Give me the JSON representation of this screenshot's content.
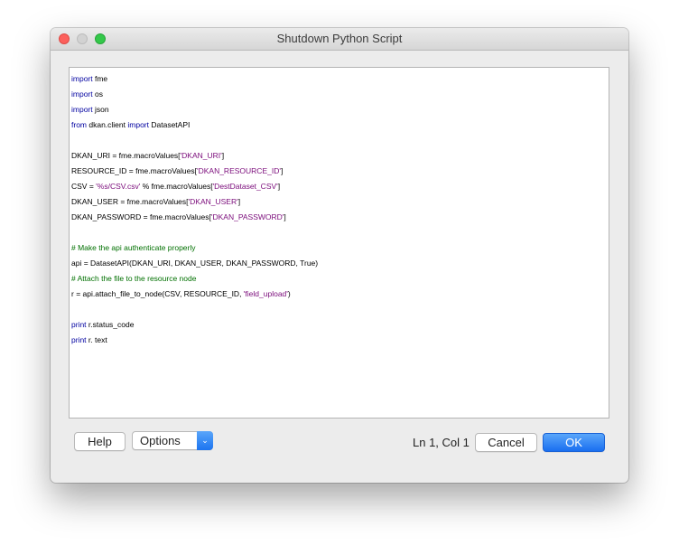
{
  "window": {
    "title": "Shutdown Python Script"
  },
  "editor": {
    "lines": [
      [
        {
          "t": "import",
          "c": "kw"
        },
        {
          "t": " fme",
          "c": "plain"
        }
      ],
      [
        {
          "t": "import",
          "c": "kw"
        },
        {
          "t": " os",
          "c": "plain"
        }
      ],
      [
        {
          "t": "import",
          "c": "kw"
        },
        {
          "t": " json",
          "c": "plain"
        }
      ],
      [
        {
          "t": "from",
          "c": "kw"
        },
        {
          "t": " dkan.client ",
          "c": "plain"
        },
        {
          "t": "import",
          "c": "kw"
        },
        {
          "t": " DatasetAPI",
          "c": "plain"
        }
      ],
      [],
      [
        {
          "t": "DKAN_URI = fme.macroValues[",
          "c": "plain"
        },
        {
          "t": "'DKAN_URI'",
          "c": "str"
        },
        {
          "t": "]",
          "c": "plain"
        }
      ],
      [
        {
          "t": "RESOURCE_ID = fme.macroValues[",
          "c": "plain"
        },
        {
          "t": "'DKAN_RESOURCE_ID'",
          "c": "str"
        },
        {
          "t": "]",
          "c": "plain"
        }
      ],
      [
        {
          "t": "CSV = ",
          "c": "plain"
        },
        {
          "t": "'%s/CSV.csv'",
          "c": "str"
        },
        {
          "t": " % fme.macroValues[",
          "c": "plain"
        },
        {
          "t": "'DestDataset_CSV'",
          "c": "str"
        },
        {
          "t": "]",
          "c": "plain"
        }
      ],
      [
        {
          "t": "DKAN_USER = fme.macroValues[",
          "c": "plain"
        },
        {
          "t": "'DKAN_USER'",
          "c": "str"
        },
        {
          "t": "]",
          "c": "plain"
        }
      ],
      [
        {
          "t": "DKAN_PASSWORD = fme.macroValues[",
          "c": "plain"
        },
        {
          "t": "'DKAN_PASSWORD'",
          "c": "str"
        },
        {
          "t": "]",
          "c": "plain"
        }
      ],
      [],
      [
        {
          "t": "# Make the api authenticate properly",
          "c": "cmt"
        }
      ],
      [
        {
          "t": "api = DatasetAPI(DKAN_URI, DKAN_USER, DKAN_PASSWORD, True)",
          "c": "plain"
        }
      ],
      [
        {
          "t": "# Attach the file to the resource node",
          "c": "cmt"
        }
      ],
      [
        {
          "t": "r = api.attach_file_to_node(CSV, RESOURCE_ID, ",
          "c": "plain"
        },
        {
          "t": "'field_upload'",
          "c": "str"
        },
        {
          "t": ")",
          "c": "plain"
        }
      ],
      [],
      [
        {
          "t": "print",
          "c": "kw"
        },
        {
          "t": " r.status_code",
          "c": "plain"
        }
      ],
      [
        {
          "t": "print",
          "c": "kw"
        },
        {
          "t": " r. text",
          "c": "plain"
        }
      ]
    ]
  },
  "footer": {
    "help_label": "Help",
    "options_label": "Options",
    "options_arrow": "⌄",
    "status": "Ln 1, Col 1",
    "cancel_label": "Cancel",
    "ok_label": "OK"
  },
  "colors": {
    "keyword": "#0000a0",
    "string": "#7a0a7a",
    "comment": "#007000",
    "accent": "#1a6ff0"
  }
}
